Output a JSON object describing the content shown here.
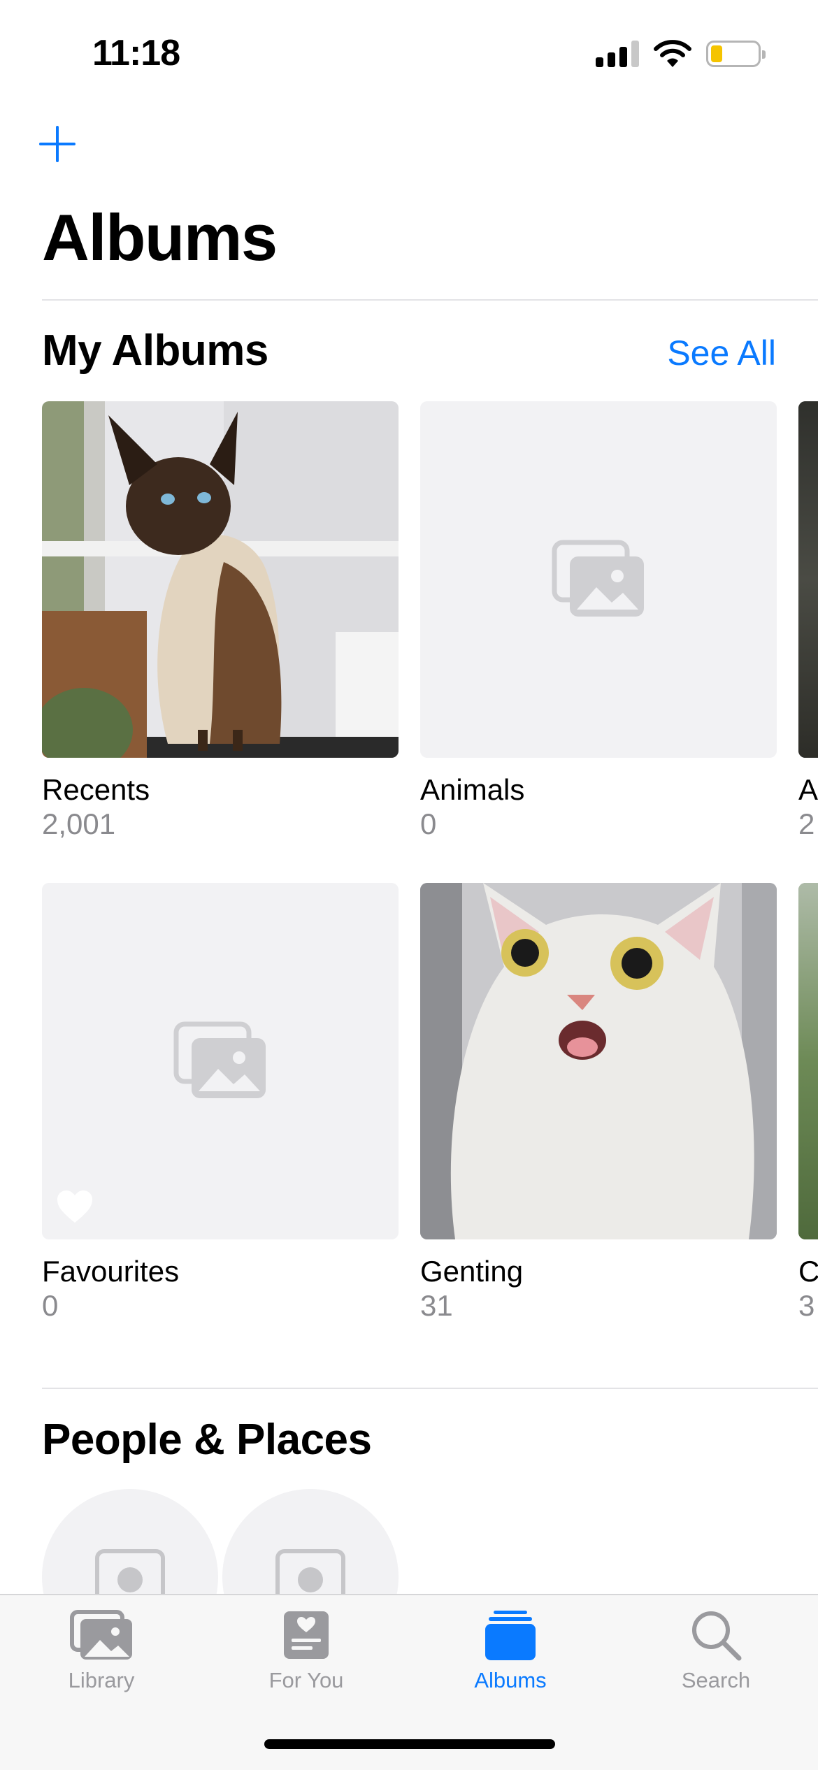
{
  "status_bar": {
    "time": "11:18"
  },
  "header": {
    "title": "Albums"
  },
  "my_albums": {
    "title": "My Albums",
    "see_all_label": "See All",
    "albums": [
      {
        "name": "Recents",
        "count": "2,001",
        "thumbnail": "siamese-cat-photo"
      },
      {
        "name": "Animals",
        "count": "0",
        "thumbnail": "empty-placeholder"
      },
      {
        "name": "A",
        "count": "2",
        "thumbnail": "partial-photo"
      },
      {
        "name": "Favourites",
        "count": "0",
        "thumbnail": "empty-placeholder"
      },
      {
        "name": "Genting",
        "count": "31",
        "thumbnail": "white-cat-photo"
      },
      {
        "name": "C",
        "count": "3",
        "thumbnail": "partial-photo"
      }
    ]
  },
  "people_places": {
    "title": "People & Places"
  },
  "tab_bar": {
    "active": "Albums",
    "tabs": [
      {
        "label": "Library",
        "icon": "photos-stack-icon"
      },
      {
        "label": "For You",
        "icon": "for-you-heart-card-icon"
      },
      {
        "label": "Albums",
        "icon": "albums-stack-icon"
      },
      {
        "label": "Search",
        "icon": "search-icon"
      }
    ]
  },
  "colors": {
    "accent": "#0a7aff",
    "secondary_text": "#8a8a8e",
    "placeholder_bg": "#f2f2f4",
    "battery": "#f5c400"
  }
}
